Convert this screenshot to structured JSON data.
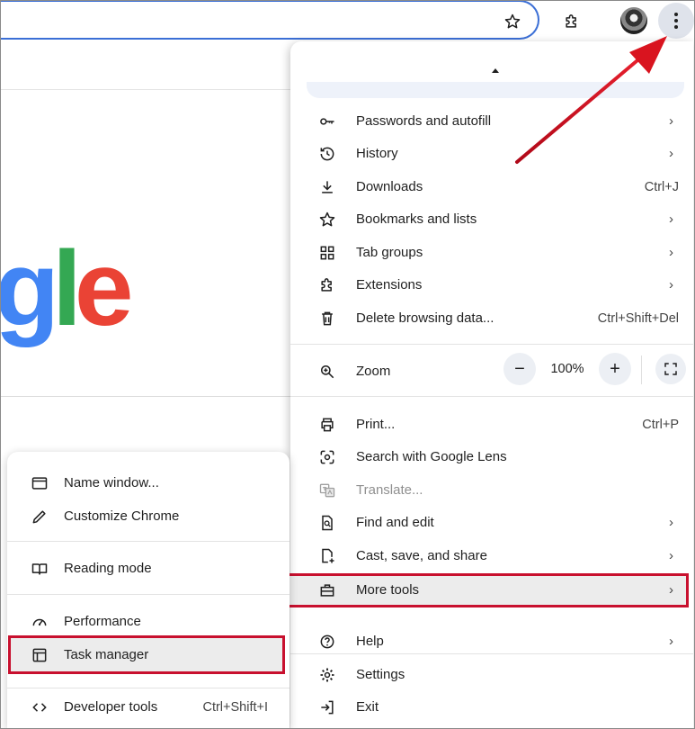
{
  "menu": {
    "items": [
      {
        "label": "Passwords and autofill",
        "icon": "key-icon",
        "chevron": true
      },
      {
        "label": "History",
        "icon": "history-icon",
        "chevron": true
      },
      {
        "label": "Downloads",
        "icon": "download-icon",
        "shortcut": "Ctrl+J"
      },
      {
        "label": "Bookmarks and lists",
        "icon": "star-icon",
        "chevron": true
      },
      {
        "label": "Tab groups",
        "icon": "tab-groups-icon",
        "chevron": true
      },
      {
        "label": "Extensions",
        "icon": "puzzle-icon",
        "chevron": true
      },
      {
        "label": "Delete browsing data...",
        "icon": "trash-icon",
        "shortcut": "Ctrl+Shift+Del"
      }
    ],
    "zoom": {
      "label": "Zoom",
      "minus": "−",
      "value": "100%",
      "plus": "+"
    },
    "items2": [
      {
        "label": "Print...",
        "icon": "printer-icon",
        "shortcut": "Ctrl+P"
      },
      {
        "label": "Search with Google Lens",
        "icon": "lens-icon"
      },
      {
        "label": "Translate...",
        "icon": "translate-icon",
        "disabled": true
      },
      {
        "label": "Find and edit",
        "icon": "find-icon",
        "chevron": true
      },
      {
        "label": "Cast, save, and share",
        "icon": "cast-save-icon",
        "chevron": true
      },
      {
        "label": "More tools",
        "icon": "toolbox-icon",
        "chevron": true,
        "highlighted": true
      }
    ],
    "items3": [
      {
        "label": "Help",
        "icon": "help-icon",
        "chevron": true
      },
      {
        "label": "Settings",
        "icon": "settings-icon"
      },
      {
        "label": "Exit",
        "icon": "exit-icon"
      }
    ],
    "chevron_glyph": "›"
  },
  "submenu": {
    "items": [
      {
        "label": "Name window...",
        "icon": "window-icon"
      },
      {
        "label": "Customize Chrome",
        "icon": "pencil-icon"
      },
      {
        "label": "Reading mode",
        "icon": "book-icon"
      },
      {
        "label": "Performance",
        "icon": "gauge-icon"
      },
      {
        "label": "Task manager",
        "icon": "task-manager-icon",
        "highlighted": true
      },
      {
        "label": "Developer tools",
        "icon": "code-icon",
        "shortcut": "Ctrl+Shift+I"
      }
    ]
  },
  "logo_text": "gle",
  "annotation_color": "#c8102e"
}
